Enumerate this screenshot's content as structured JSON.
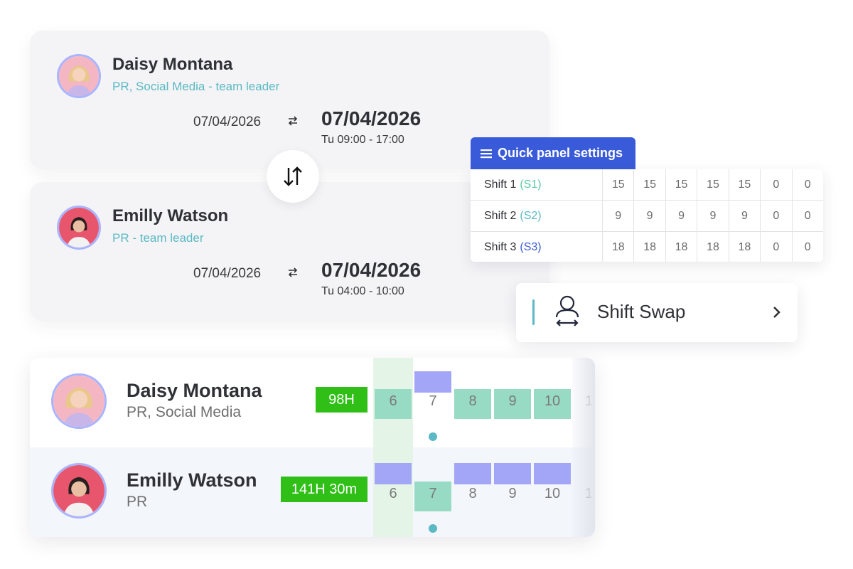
{
  "swap_cards": [
    {
      "name": "Daisy Montana",
      "role": "PR, Social Media - team leader",
      "from_date": "07/04/2026",
      "to_date": "07/04/2026",
      "time": "Tu  09:00 - 17:00"
    },
    {
      "name": "Emilly Watson",
      "role": "PR - team leader",
      "from_date": "07/04/2026",
      "to_date": "07/04/2026",
      "time": "Tu  04:00 - 10:00"
    }
  ],
  "quick_panel": {
    "title": "Quick panel settings",
    "rows": [
      {
        "label": "Shift 1",
        "code": "(S1)",
        "code_color": "#5bc9a0",
        "values": [
          "15",
          "15",
          "15",
          "15",
          "15",
          "0",
          "0"
        ]
      },
      {
        "label": "Shift 2",
        "code": "(S2)",
        "code_color": "#5bb9c4",
        "values": [
          "9",
          "9",
          "9",
          "9",
          "9",
          "0",
          "0"
        ]
      },
      {
        "label": "Shift 3",
        "code": "(S3)",
        "code_color": "#3a5bd9",
        "values": [
          "18",
          "18",
          "18",
          "18",
          "18",
          "0",
          "0"
        ]
      }
    ]
  },
  "shift_swap": {
    "label": "Shift Swap"
  },
  "schedule": {
    "rows": [
      {
        "name": "Daisy Montana",
        "role": "PR, Social Media",
        "hours": "98H",
        "days": [
          "6",
          "7",
          "8",
          "9",
          "10",
          "1"
        ]
      },
      {
        "name": "Emilly Watson",
        "role": "PR",
        "hours": "141H 30m",
        "days": [
          "6",
          "7",
          "8",
          "9",
          "10",
          "1"
        ]
      }
    ]
  },
  "colors": {
    "accent_blue": "#3a5bd9",
    "teal": "#5bb9c4",
    "hours_green": "#2fbf16",
    "shift_green": "#98dbc4",
    "shift_purple": "#a3a6f7"
  }
}
